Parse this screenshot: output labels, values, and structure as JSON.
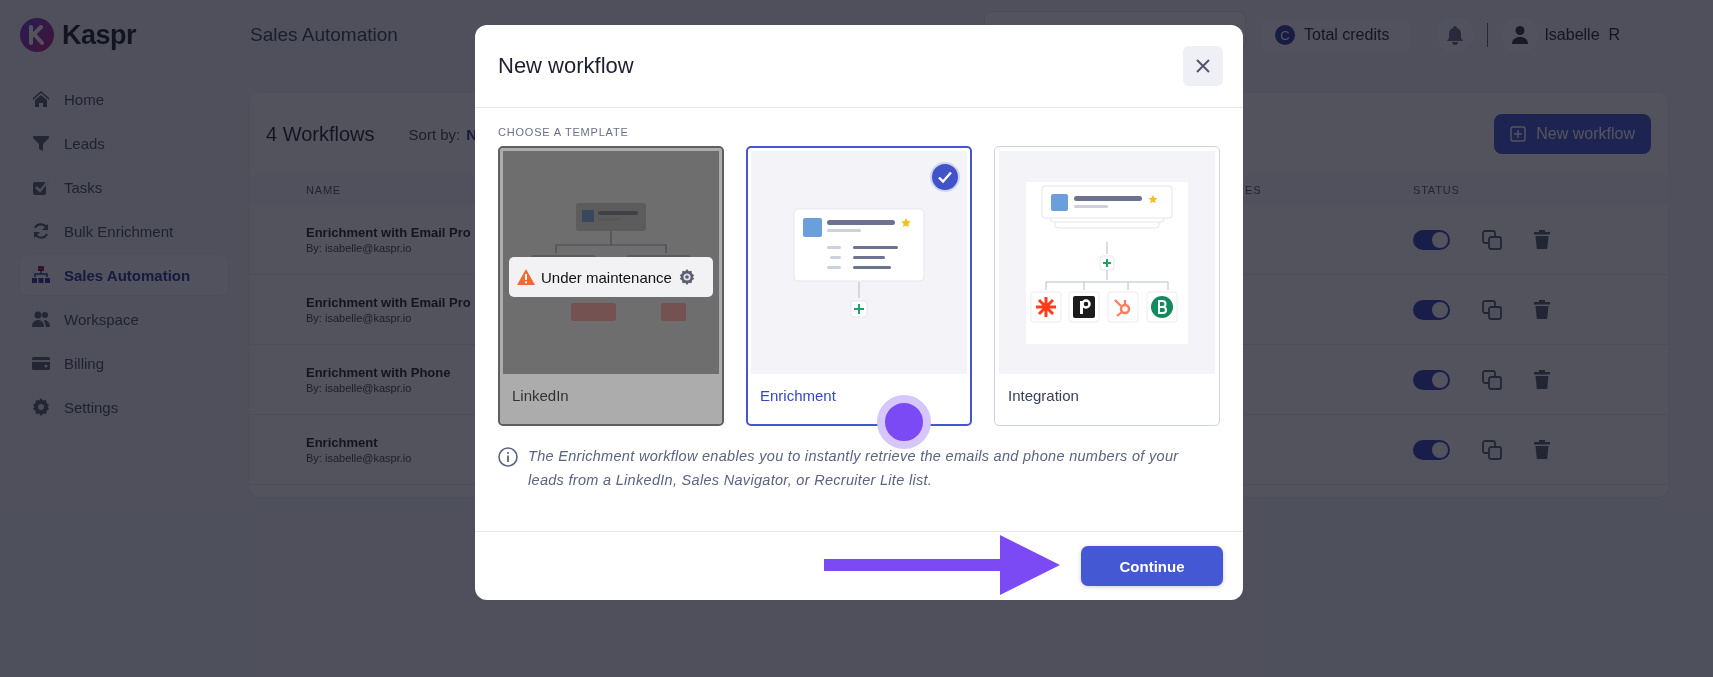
{
  "brand": "Kaspr",
  "sidebar": {
    "items": [
      {
        "label": "Home",
        "selected": false
      },
      {
        "label": "Leads",
        "selected": false
      },
      {
        "label": "Tasks",
        "selected": false
      },
      {
        "label": "Bulk Enrichment",
        "selected": false
      },
      {
        "label": "Sales Automation",
        "selected": true
      },
      {
        "label": "Workspace",
        "selected": false
      },
      {
        "label": "Billing",
        "selected": false
      },
      {
        "label": "Settings",
        "selected": false
      }
    ]
  },
  "header": {
    "title": "Sales Automation",
    "credits": {
      "badge": "C",
      "label": "Total credits"
    },
    "user": {
      "first": "Isabelle",
      "last": "R"
    }
  },
  "workflows": {
    "count_title": "4 Workflows",
    "sort_label": "Sort by:",
    "sort_value": "N",
    "new_button": "New workflow",
    "columns": [
      "NAME",
      "ES",
      "STATUS"
    ],
    "rows": [
      {
        "name": "Enrichment with Email Pro",
        "author": "By: isabelle@kaspr.io",
        "on": true
      },
      {
        "name": "Enrichment with Email Pro",
        "author": "By: isabelle@kaspr.io",
        "on": true
      },
      {
        "name": "Enrichment with Phone",
        "author": "By: isabelle@kaspr.io",
        "on": true
      },
      {
        "name": "Enrichment",
        "author": "By: isabelle@kaspr.io",
        "on": true
      }
    ]
  },
  "modal": {
    "title": "New workflow",
    "section": "CHOOSE A TEMPLATE",
    "templates": [
      {
        "label": "LinkedIn",
        "kind": "tree",
        "selected": false,
        "disabled": true,
        "notice": "Under maintenance"
      },
      {
        "label": "Enrichment",
        "kind": "single",
        "selected": true,
        "disabled": false
      },
      {
        "label": "Integration",
        "kind": "branches",
        "selected": false,
        "disabled": false
      }
    ],
    "info": "The Enrichment workflow enables you to instantly retrieve the emails and phone numbers of your leads from a LinkedIn, Sales Navigator, or Recruiter Lite list.",
    "continue": "Continue"
  }
}
